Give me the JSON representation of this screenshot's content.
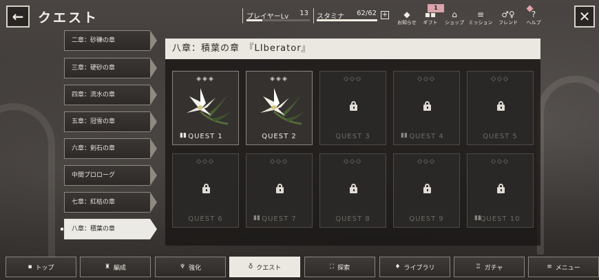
{
  "header": {
    "back_icon": "←",
    "title": "クエスト",
    "player_label": "プレイヤーLv",
    "player_level": "13",
    "player_progress": 0.25,
    "stamina_label": "スタミナ",
    "stamina_value": "62/62",
    "stamina_progress": 1.0,
    "stamina_plus": "+",
    "close_icon": "✕",
    "gift_badge": "1",
    "nav": [
      {
        "label": "お知らせ",
        "icon": "◆"
      },
      {
        "label": "ギフト",
        "icon": "▪▪"
      },
      {
        "label": "ショップ",
        "icon": "⌂"
      },
      {
        "label": "ミッション",
        "icon": "≡"
      },
      {
        "label": "フレンド",
        "icon": "♂♀"
      },
      {
        "label": "ヘルプ",
        "icon": "?"
      }
    ]
  },
  "chapters": [
    {
      "label": "二章：砂礫の章"
    },
    {
      "label": "三章：硬砂の章"
    },
    {
      "label": "四章：流水の章"
    },
    {
      "label": "五章：冠雪の章"
    },
    {
      "label": "六章：剣石の章"
    },
    {
      "label": "中間プロローグ"
    },
    {
      "label": "七章：紅枯の章"
    },
    {
      "label": "八章：積葉の章"
    }
  ],
  "panel": {
    "title": "八章：積葉の章　『LIberator』"
  },
  "quests": [
    {
      "label": "QUEST 1",
      "diamonds": "◈◈◈",
      "unlocked": true,
      "has_book": true
    },
    {
      "label": "QUEST 2",
      "diamonds": "◈◈◈",
      "unlocked": true,
      "has_book": false
    },
    {
      "label": "QUEST 3",
      "diamonds": "◇◇◇",
      "unlocked": false,
      "has_book": false
    },
    {
      "label": "QUEST 4",
      "diamonds": "◇◇◇",
      "unlocked": false,
      "has_book": true
    },
    {
      "label": "QUEST 5",
      "diamonds": "◇◇◇",
      "unlocked": false,
      "has_book": false
    },
    {
      "label": "QUEST 6",
      "diamonds": "◇◇◇",
      "unlocked": false,
      "has_book": false
    },
    {
      "label": "QUEST 7",
      "diamonds": "◇◇◇",
      "unlocked": false,
      "has_book": true
    },
    {
      "label": "QUEST 8",
      "diamonds": "◇◇◇",
      "unlocked": false,
      "has_book": false
    },
    {
      "label": "QUEST 9",
      "diamonds": "◇◇◇",
      "unlocked": false,
      "has_book": false
    },
    {
      "label": "QUEST 10",
      "diamonds": "◇◇◇",
      "unlocked": false,
      "has_book": true
    }
  ],
  "bottom_nav": [
    {
      "label": "トップ",
      "icon": "▪"
    },
    {
      "label": "編成",
      "icon": "♜"
    },
    {
      "label": "強化",
      "icon": "♆"
    },
    {
      "label": "クエスト",
      "icon": "♁"
    },
    {
      "label": "探索",
      "icon": "⛶"
    },
    {
      "label": "ライブラリ",
      "icon": "♦"
    },
    {
      "label": "ガチャ",
      "icon": "♖"
    },
    {
      "label": "メニュー",
      "icon": "≡"
    }
  ]
}
